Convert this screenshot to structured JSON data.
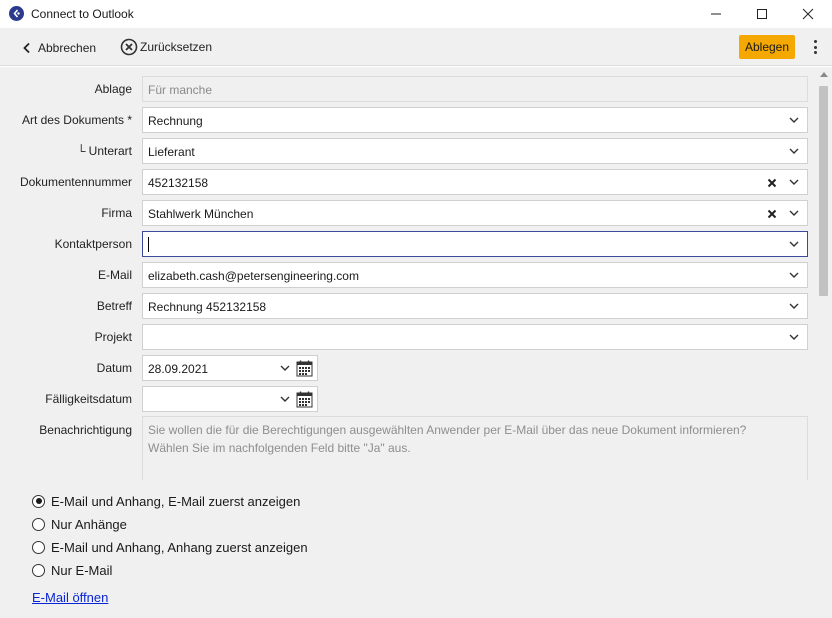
{
  "window": {
    "title": "Connect to Outlook"
  },
  "toolbar": {
    "back_label": "Abbrechen",
    "reset_label": "Zurücksetzen",
    "file_label": "Ablegen",
    "accent_color": "#f5a800"
  },
  "form": {
    "ablage": {
      "label": "Ablage",
      "placeholder": "Für manche"
    },
    "art": {
      "label": "Art des Dokuments *",
      "value": "Rechnung"
    },
    "unterart": {
      "label": "└ Unterart",
      "value": "Lieferant"
    },
    "dokumentennummer": {
      "label": "Dokumentennummer",
      "value": "452132158"
    },
    "firma": {
      "label": "Firma",
      "value": "Stahlwerk München"
    },
    "kontaktperson": {
      "label": "Kontaktperson",
      "value": ""
    },
    "email": {
      "label": "E-Mail",
      "value": "elizabeth.cash@petersengineering.com"
    },
    "betreff": {
      "label": "Betreff",
      "value": "Rechnung 452132158"
    },
    "projekt": {
      "label": "Projekt",
      "value": ""
    },
    "datum": {
      "label": "Datum",
      "value": "28.09.2021"
    },
    "faelligkeit": {
      "label": "Fälligkeitsdatum",
      "value": ""
    },
    "benachrichtigung": {
      "label": "Benachrichtigung",
      "line1": "Sie wollen die für die Berechtigungen ausgewählten Anwender per E-Mail über das neue Dokument informieren?",
      "line2": "Wählen Sie im nachfolgenden Feld bitte \"Ja\" aus."
    }
  },
  "options": {
    "items": [
      {
        "label": "E-Mail und Anhang, E-Mail zuerst anzeigen",
        "checked": true
      },
      {
        "label": "Nur Anhänge",
        "checked": false
      },
      {
        "label": "E-Mail und Anhang, Anhang zuerst anzeigen",
        "checked": false
      },
      {
        "label": "Nur E-Mail",
        "checked": false
      }
    ],
    "link_label": "E-Mail öffnen"
  }
}
